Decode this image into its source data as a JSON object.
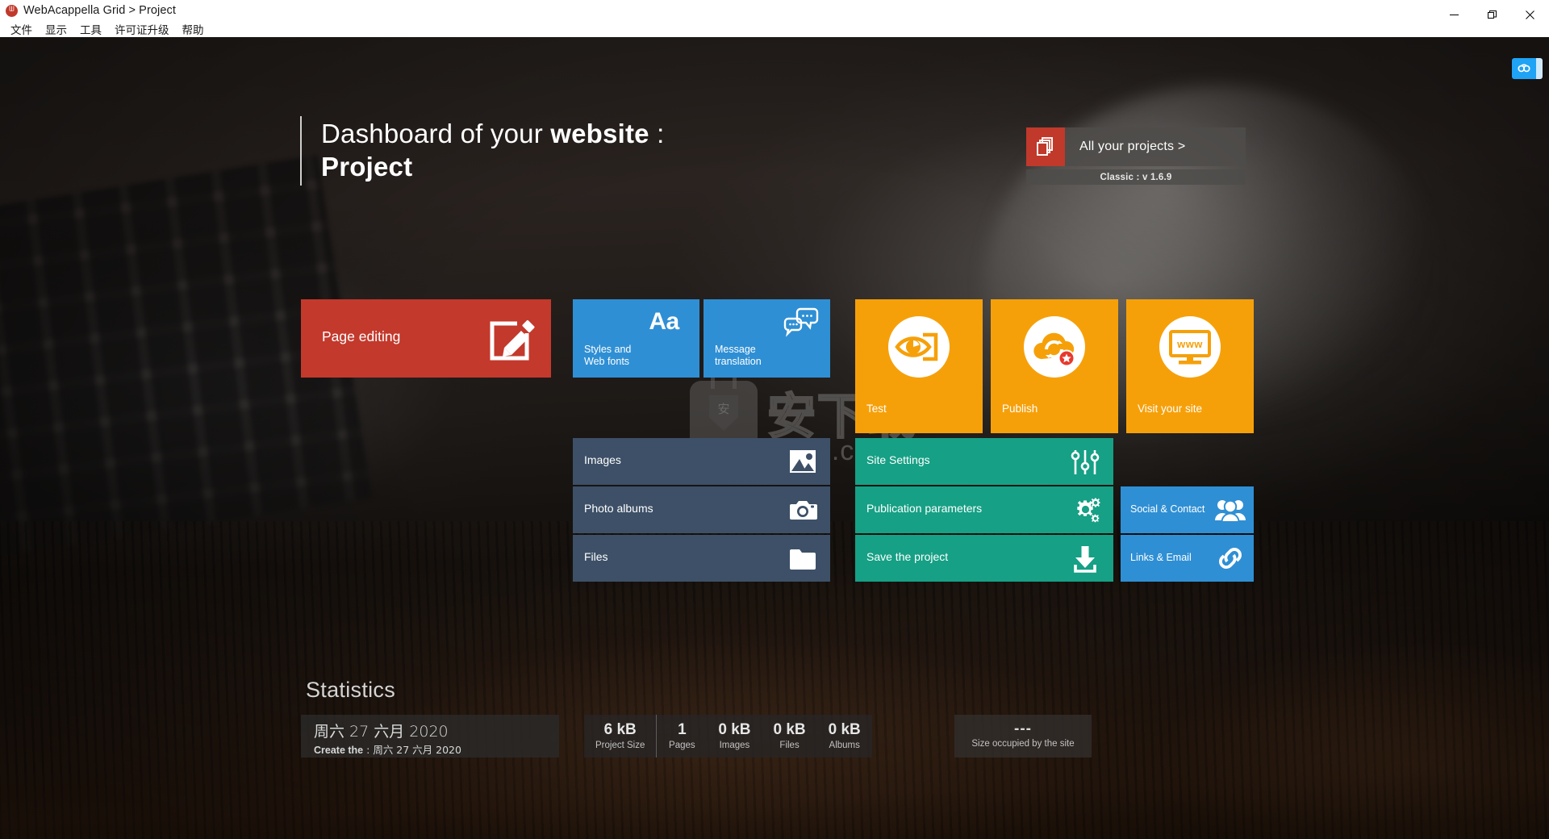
{
  "window": {
    "app_title": "WebAcappella Grid  >  Project",
    "logo_icon": "webacappella-logo-icon",
    "menu": [
      {
        "label": "文件",
        "name": "menu-file"
      },
      {
        "label": "显示",
        "name": "menu-display"
      },
      {
        "label": "工具",
        "name": "menu-tools"
      },
      {
        "label": "许可证升级",
        "name": "menu-license-upgrade"
      },
      {
        "label": "帮助",
        "name": "menu-help"
      }
    ],
    "controls": {
      "minimize": "minimize-icon",
      "maximize": "maximize-icon",
      "close": "close-icon"
    }
  },
  "sync_badge": {
    "icon": "cloud-sync-icon"
  },
  "headline": {
    "line1_prefix": "Dashboard of your ",
    "line1_bold": "website",
    "line1_suffix": " :",
    "line2": "Project"
  },
  "projects": {
    "icon": "documents-stack-icon",
    "label": "All your projects  >",
    "version": "Classic : v 1.6.9"
  },
  "watermark": {
    "chinese": "安下载",
    "url": "anxz.com",
    "badge_char": "安"
  },
  "tiles": {
    "page_editing": {
      "label": "Page editing",
      "icon": "edit-square-pencil-icon",
      "color": "#c3392c"
    },
    "styles": {
      "label": "Styles and\nWeb fonts",
      "icon": "aa-typography-icon",
      "glyph": "Aa",
      "color": "#2f8fd4"
    },
    "translation": {
      "label": "Message\ntranslation",
      "icon": "speech-bubbles-icon",
      "color": "#2f8fd4"
    },
    "test": {
      "label": "Test",
      "icon": "eye-preview-icon",
      "color": "#f6a009"
    },
    "publish": {
      "label": "Publish",
      "icon": "cloud-publish-star-icon",
      "color": "#f6a009"
    },
    "visit": {
      "label": "Visit your site",
      "icon": "monitor-www-icon",
      "glyph": "www",
      "color": "#f6a009"
    },
    "images": {
      "label": "Images",
      "icon": "picture-icon",
      "color": "#3d5067"
    },
    "photo_albums": {
      "label": "Photo albums",
      "icon": "camera-icon",
      "color": "#3d5067"
    },
    "files": {
      "label": "Files",
      "icon": "folder-icon",
      "color": "#3d5067"
    },
    "site_settings": {
      "label": "Site Settings",
      "icon": "sliders-icon",
      "color": "#16a085"
    },
    "publication_parameters": {
      "label": "Publication parameters",
      "icon": "gears-icon",
      "color": "#16a085"
    },
    "save_project": {
      "label": "Save the project",
      "icon": "download-save-icon",
      "color": "#16a085"
    },
    "social_contact": {
      "label": "Social & Contact",
      "icon": "people-group-icon",
      "color": "#2f8fd4"
    },
    "links_email": {
      "label": "Links & Email",
      "icon": "chain-link-icon",
      "color": "#2f8fd4"
    }
  },
  "statistics": {
    "title": "Statistics",
    "date_main": "周六 27 六月 2020",
    "created_label": "Create the",
    "created_sep": " : ",
    "created_value": "周六 27 六月 2020",
    "metrics": [
      {
        "value": "6 kB",
        "label": "Project Size"
      },
      {
        "value": "1",
        "label": "Pages"
      },
      {
        "value": "0 kB",
        "label": "Images"
      },
      {
        "value": "0 kB",
        "label": "Files"
      },
      {
        "value": "0 kB",
        "label": "Albums"
      }
    ],
    "site_size": {
      "value": "---",
      "label": "Size occupied by the site"
    }
  }
}
